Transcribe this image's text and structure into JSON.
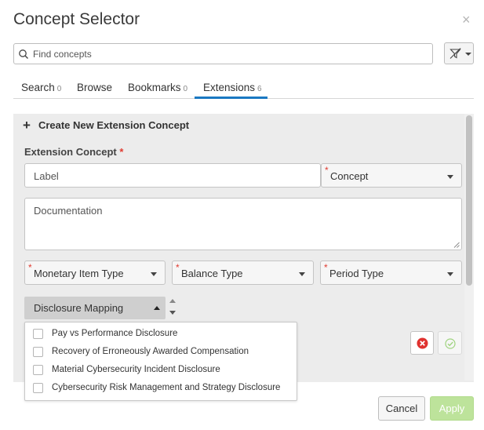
{
  "dialog": {
    "title": "Concept Selector",
    "close_glyph": "×"
  },
  "search": {
    "placeholder": "Find concepts",
    "icon": "search-icon",
    "filter_icon": "filter-icon"
  },
  "tabs": [
    {
      "label": "Search",
      "count": "0"
    },
    {
      "label": "Browse",
      "count": ""
    },
    {
      "label": "Bookmarks",
      "count": "0"
    },
    {
      "label": "Extensions",
      "count": "6",
      "active": true
    }
  ],
  "extension_form": {
    "header": "Create New Extension Concept",
    "plus_glyph": "+",
    "concept_label": "Extension Concept",
    "required_mark": "*",
    "label_placeholder": "Label",
    "concept_select": "Concept",
    "documentation_placeholder": "Documentation",
    "monetary_select": "Monetary Item Type",
    "balance_select": "Balance Type",
    "period_select": "Period Type",
    "disclosure_mapping": "Disclosure Mapping",
    "disclosure_options": [
      {
        "label": "Pay vs Performance Disclosure",
        "checked": false
      },
      {
        "label": "Recovery of Erroneously Awarded Compensation",
        "checked": false
      },
      {
        "label": "Material Cybersecurity Incident Disclosure",
        "checked": false
      },
      {
        "label": "Cybersecurity Risk Management and Strategy Disclosure",
        "checked": false
      }
    ]
  },
  "footer": {
    "cancel_label": "Cancel",
    "apply_label": "Apply"
  },
  "colors": {
    "accent": "#1a78c2",
    "required": "#e03c31",
    "apply_disabled": "#bde39b",
    "discard": "#e0322f",
    "confirm": "#9fd37f"
  }
}
